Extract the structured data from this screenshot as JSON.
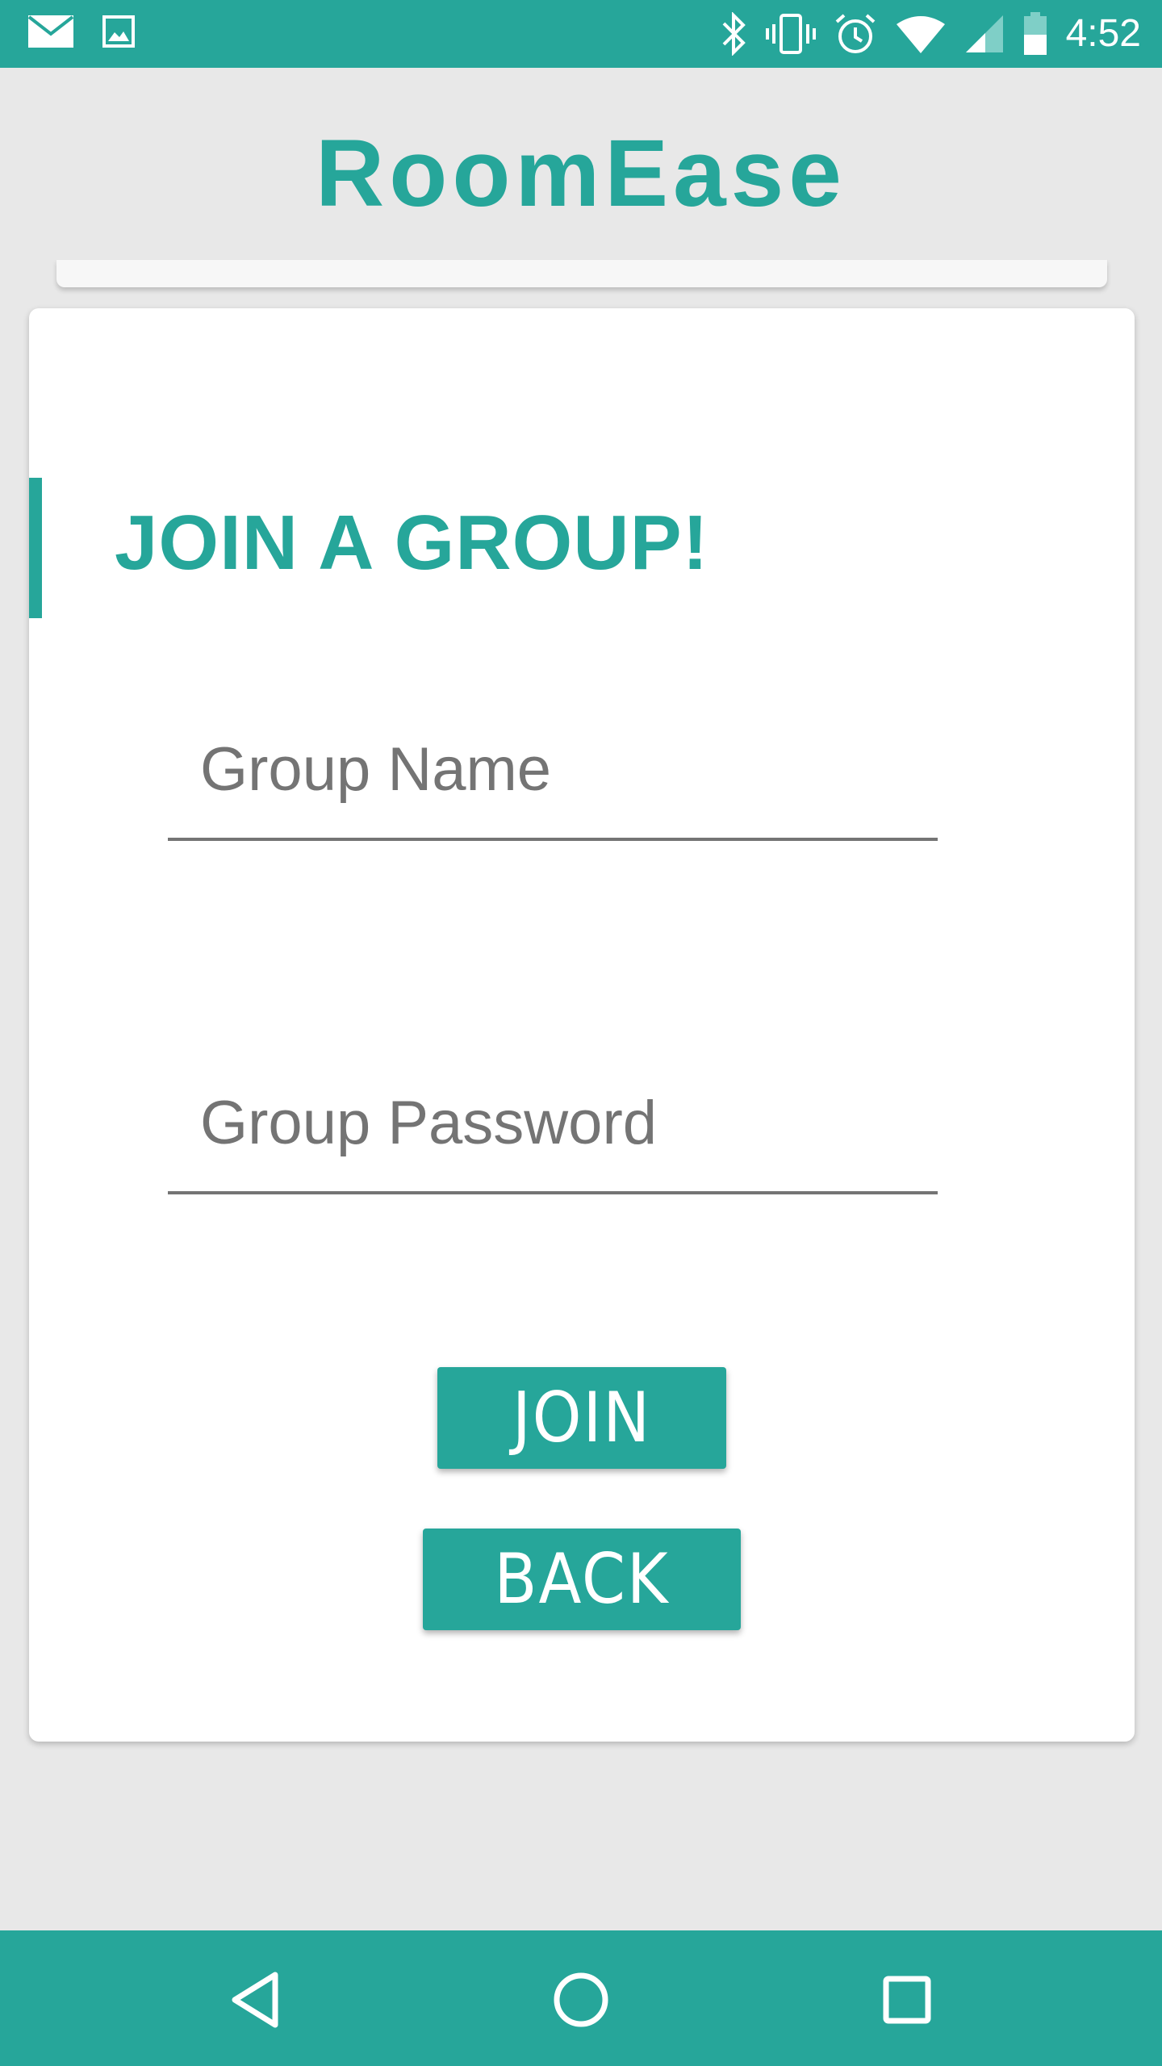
{
  "status_bar": {
    "time": "4:52",
    "icons_left": [
      "mail-icon",
      "image-icon"
    ],
    "icons_right": [
      "bluetooth-icon",
      "vibrate-icon",
      "alarm-icon",
      "wifi-icon",
      "cell-signal-icon",
      "battery-icon"
    ]
  },
  "app": {
    "title": "RoomEase",
    "accent_color": "#26a69a"
  },
  "card": {
    "heading": "JOIN A GROUP!"
  },
  "form": {
    "group_name_placeholder": "Group Name",
    "group_name_value": "",
    "group_password_placeholder": "Group Password",
    "group_password_value": ""
  },
  "buttons": {
    "join_label": "JOIN",
    "back_label": "BACK"
  },
  "nav_bar": {
    "icons": [
      "nav-back-icon",
      "nav-home-icon",
      "nav-recents-icon"
    ]
  }
}
